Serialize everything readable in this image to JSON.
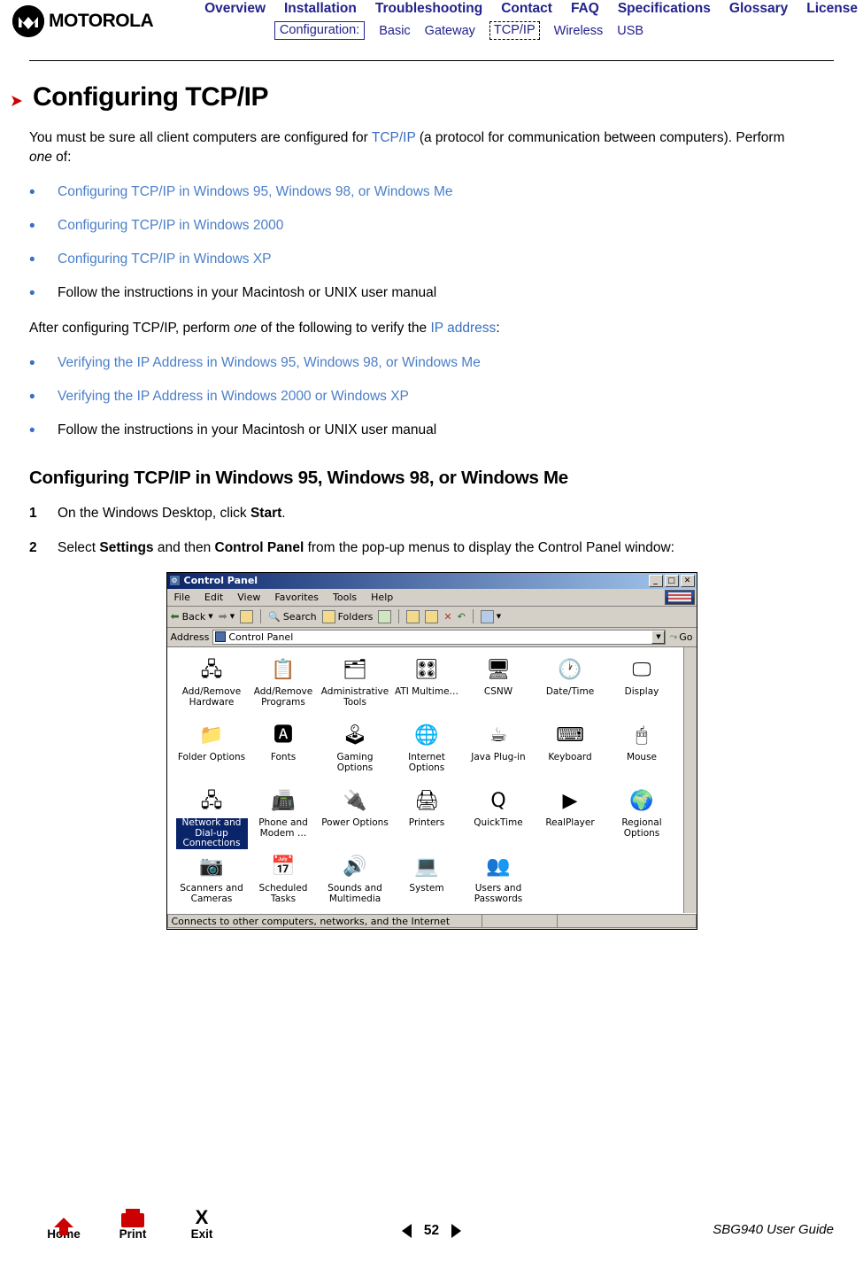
{
  "header": {
    "logo_text": "MOTOROLA",
    "nav_primary": [
      "Overview",
      "Installation",
      "Troubleshooting",
      "Contact",
      "FAQ",
      "Specifications",
      "Glossary",
      "License"
    ],
    "config_label": "Configuration:",
    "nav_secondary": [
      "Basic",
      "Gateway",
      "TCP/IP",
      "Wireless",
      "USB"
    ],
    "nav_secondary_active": "TCP/IP"
  },
  "page": {
    "title": "Configuring TCP/IP",
    "intro_part1": "You must be sure all client computers are configured for ",
    "intro_link": "TCP/IP",
    "intro_part2": " (a protocol for communication between computers). Perform ",
    "intro_em": "one",
    "intro_part3": " of:",
    "list1": [
      {
        "text": "Configuring TCP/IP in Windows 95, Windows 98, or Windows Me",
        "link": true
      },
      {
        "text": "Configuring TCP/IP in Windows 2000",
        "link": true
      },
      {
        "text": "Configuring TCP/IP in Windows XP",
        "link": true
      },
      {
        "text": "Follow the instructions in your Macintosh or UNIX user manual",
        "link": false
      }
    ],
    "mid_part1": "After configuring TCP/IP, perform ",
    "mid_em": "one",
    "mid_part2": " of the following to verify the ",
    "mid_link": "IP address",
    "mid_part3": ":",
    "list2": [
      {
        "text": "Verifying the IP Address in Windows 95, Windows 98, or Windows Me",
        "link": true
      },
      {
        "text": "Verifying the IP Address in Windows 2000 or Windows XP",
        "link": true
      },
      {
        "text": "Follow the instructions in your Macintosh or UNIX user manual",
        "link": false
      }
    ],
    "section_heading": "Configuring TCP/IP in Windows 95, Windows 98, or Windows Me",
    "steps": [
      {
        "num": "1",
        "pre": "On the Windows Desktop, click ",
        "bold": "Start",
        "post": "."
      },
      {
        "num": "2",
        "pre": "Select ",
        "bold": "Settings",
        "mid": " and then ",
        "bold2": "Control Panel",
        "post": " from the pop-up menus to display the Control Panel window:"
      }
    ]
  },
  "control_panel": {
    "window_title": "Control Panel",
    "window_buttons": [
      "_",
      "□",
      "✕"
    ],
    "menus": [
      "File",
      "Edit",
      "View",
      "Favorites",
      "Tools",
      "Help"
    ],
    "toolbar": [
      "Back",
      "Search",
      "Folders"
    ],
    "address_label": "Address",
    "address_value": "Control Panel",
    "go_label": "Go",
    "icons": [
      {
        "label": "Add/Remove Hardware",
        "glyph": "🖧",
        "selected": false
      },
      {
        "label": "Add/Remove Programs",
        "glyph": "📋",
        "selected": false
      },
      {
        "label": "Administrative Tools",
        "glyph": "🗂",
        "selected": false
      },
      {
        "label": "ATI Multime…",
        "glyph": "🎛",
        "selected": false
      },
      {
        "label": "CSNW",
        "glyph": "🖥",
        "selected": false
      },
      {
        "label": "Date/Time",
        "glyph": "🕐",
        "selected": false
      },
      {
        "label": "Display",
        "glyph": "🖵",
        "selected": false
      },
      {
        "label": "Folder Options",
        "glyph": "📁",
        "selected": false
      },
      {
        "label": "Fonts",
        "glyph": "🅰",
        "selected": false
      },
      {
        "label": "Gaming Options",
        "glyph": "🕹",
        "selected": false
      },
      {
        "label": "Internet Options",
        "glyph": "🌐",
        "selected": false
      },
      {
        "label": "Java Plug-in",
        "glyph": "☕",
        "selected": false
      },
      {
        "label": "Keyboard",
        "glyph": "⌨",
        "selected": false
      },
      {
        "label": "Mouse",
        "glyph": "🖱",
        "selected": false
      },
      {
        "label": "Network and Dial-up Connections",
        "glyph": "🖧",
        "selected": true
      },
      {
        "label": "Phone and Modem …",
        "glyph": "📠",
        "selected": false
      },
      {
        "label": "Power Options",
        "glyph": "🔌",
        "selected": false
      },
      {
        "label": "Printers",
        "glyph": "🖨",
        "selected": false
      },
      {
        "label": "QuickTime",
        "glyph": "Q",
        "selected": false
      },
      {
        "label": "RealPlayer",
        "glyph": "▶",
        "selected": false
      },
      {
        "label": "Regional Options",
        "glyph": "🌍",
        "selected": false
      },
      {
        "label": "Scanners and Cameras",
        "glyph": "📷",
        "selected": false
      },
      {
        "label": "Scheduled Tasks",
        "glyph": "📅",
        "selected": false
      },
      {
        "label": "Sounds and Multimedia",
        "glyph": "🔊",
        "selected": false
      },
      {
        "label": "System",
        "glyph": "💻",
        "selected": false
      },
      {
        "label": "Users and Passwords",
        "glyph": "👥",
        "selected": false
      }
    ],
    "status_text": "Connects to other computers, networks, and the Internet"
  },
  "footer": {
    "home_label": "Home",
    "print_label": "Print",
    "exit_label": "Exit",
    "exit_glyph": "X",
    "page_number": "52",
    "guide_text": "SBG940 User Guide"
  }
}
